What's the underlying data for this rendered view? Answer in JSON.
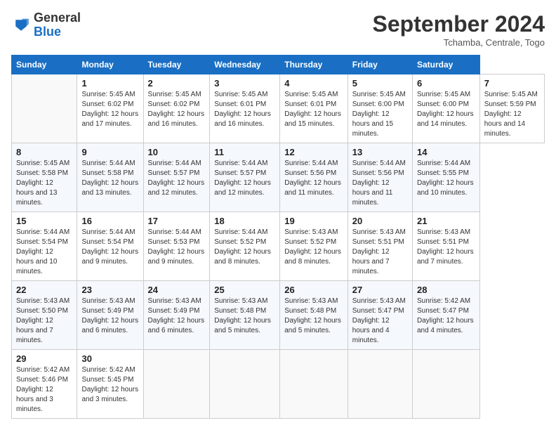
{
  "header": {
    "logo": {
      "general": "General",
      "blue": "Blue",
      "arrow_color": "#1a6fc4"
    },
    "title": "September 2024",
    "subtitle": "Tchamba, Centrale, Togo"
  },
  "calendar": {
    "days_of_week": [
      "Sunday",
      "Monday",
      "Tuesday",
      "Wednesday",
      "Thursday",
      "Friday",
      "Saturday"
    ],
    "weeks": [
      [
        null,
        {
          "date": "1",
          "sunrise": "Sunrise: 5:45 AM",
          "sunset": "Sunset: 6:02 PM",
          "daylight": "Daylight: 12 hours and 17 minutes."
        },
        {
          "date": "2",
          "sunrise": "Sunrise: 5:45 AM",
          "sunset": "Sunset: 6:02 PM",
          "daylight": "Daylight: 12 hours and 16 minutes."
        },
        {
          "date": "3",
          "sunrise": "Sunrise: 5:45 AM",
          "sunset": "Sunset: 6:01 PM",
          "daylight": "Daylight: 12 hours and 16 minutes."
        },
        {
          "date": "4",
          "sunrise": "Sunrise: 5:45 AM",
          "sunset": "Sunset: 6:01 PM",
          "daylight": "Daylight: 12 hours and 15 minutes."
        },
        {
          "date": "5",
          "sunrise": "Sunrise: 5:45 AM",
          "sunset": "Sunset: 6:00 PM",
          "daylight": "Daylight: 12 hours and 15 minutes."
        },
        {
          "date": "6",
          "sunrise": "Sunrise: 5:45 AM",
          "sunset": "Sunset: 6:00 PM",
          "daylight": "Daylight: 12 hours and 14 minutes."
        },
        {
          "date": "7",
          "sunrise": "Sunrise: 5:45 AM",
          "sunset": "Sunset: 5:59 PM",
          "daylight": "Daylight: 12 hours and 14 minutes."
        }
      ],
      [
        {
          "date": "8",
          "sunrise": "Sunrise: 5:45 AM",
          "sunset": "Sunset: 5:58 PM",
          "daylight": "Daylight: 12 hours and 13 minutes."
        },
        {
          "date": "9",
          "sunrise": "Sunrise: 5:44 AM",
          "sunset": "Sunset: 5:58 PM",
          "daylight": "Daylight: 12 hours and 13 minutes."
        },
        {
          "date": "10",
          "sunrise": "Sunrise: 5:44 AM",
          "sunset": "Sunset: 5:57 PM",
          "daylight": "Daylight: 12 hours and 12 minutes."
        },
        {
          "date": "11",
          "sunrise": "Sunrise: 5:44 AM",
          "sunset": "Sunset: 5:57 PM",
          "daylight": "Daylight: 12 hours and 12 minutes."
        },
        {
          "date": "12",
          "sunrise": "Sunrise: 5:44 AM",
          "sunset": "Sunset: 5:56 PM",
          "daylight": "Daylight: 12 hours and 11 minutes."
        },
        {
          "date": "13",
          "sunrise": "Sunrise: 5:44 AM",
          "sunset": "Sunset: 5:56 PM",
          "daylight": "Daylight: 12 hours and 11 minutes."
        },
        {
          "date": "14",
          "sunrise": "Sunrise: 5:44 AM",
          "sunset": "Sunset: 5:55 PM",
          "daylight": "Daylight: 12 hours and 10 minutes."
        }
      ],
      [
        {
          "date": "15",
          "sunrise": "Sunrise: 5:44 AM",
          "sunset": "Sunset: 5:54 PM",
          "daylight": "Daylight: 12 hours and 10 minutes."
        },
        {
          "date": "16",
          "sunrise": "Sunrise: 5:44 AM",
          "sunset": "Sunset: 5:54 PM",
          "daylight": "Daylight: 12 hours and 9 minutes."
        },
        {
          "date": "17",
          "sunrise": "Sunrise: 5:44 AM",
          "sunset": "Sunset: 5:53 PM",
          "daylight": "Daylight: 12 hours and 9 minutes."
        },
        {
          "date": "18",
          "sunrise": "Sunrise: 5:44 AM",
          "sunset": "Sunset: 5:52 PM",
          "daylight": "Daylight: 12 hours and 8 minutes."
        },
        {
          "date": "19",
          "sunrise": "Sunrise: 5:43 AM",
          "sunset": "Sunset: 5:52 PM",
          "daylight": "Daylight: 12 hours and 8 minutes."
        },
        {
          "date": "20",
          "sunrise": "Sunrise: 5:43 AM",
          "sunset": "Sunset: 5:51 PM",
          "daylight": "Daylight: 12 hours and 7 minutes."
        },
        {
          "date": "21",
          "sunrise": "Sunrise: 5:43 AM",
          "sunset": "Sunset: 5:51 PM",
          "daylight": "Daylight: 12 hours and 7 minutes."
        }
      ],
      [
        {
          "date": "22",
          "sunrise": "Sunrise: 5:43 AM",
          "sunset": "Sunset: 5:50 PM",
          "daylight": "Daylight: 12 hours and 7 minutes."
        },
        {
          "date": "23",
          "sunrise": "Sunrise: 5:43 AM",
          "sunset": "Sunset: 5:49 PM",
          "daylight": "Daylight: 12 hours and 6 minutes."
        },
        {
          "date": "24",
          "sunrise": "Sunrise: 5:43 AM",
          "sunset": "Sunset: 5:49 PM",
          "daylight": "Daylight: 12 hours and 6 minutes."
        },
        {
          "date": "25",
          "sunrise": "Sunrise: 5:43 AM",
          "sunset": "Sunset: 5:48 PM",
          "daylight": "Daylight: 12 hours and 5 minutes."
        },
        {
          "date": "26",
          "sunrise": "Sunrise: 5:43 AM",
          "sunset": "Sunset: 5:48 PM",
          "daylight": "Daylight: 12 hours and 5 minutes."
        },
        {
          "date": "27",
          "sunrise": "Sunrise: 5:43 AM",
          "sunset": "Sunset: 5:47 PM",
          "daylight": "Daylight: 12 hours and 4 minutes."
        },
        {
          "date": "28",
          "sunrise": "Sunrise: 5:42 AM",
          "sunset": "Sunset: 5:47 PM",
          "daylight": "Daylight: 12 hours and 4 minutes."
        }
      ],
      [
        {
          "date": "29",
          "sunrise": "Sunrise: 5:42 AM",
          "sunset": "Sunset: 5:46 PM",
          "daylight": "Daylight: 12 hours and 3 minutes."
        },
        {
          "date": "30",
          "sunrise": "Sunrise: 5:42 AM",
          "sunset": "Sunset: 5:45 PM",
          "daylight": "Daylight: 12 hours and 3 minutes."
        },
        null,
        null,
        null,
        null,
        null
      ]
    ]
  }
}
